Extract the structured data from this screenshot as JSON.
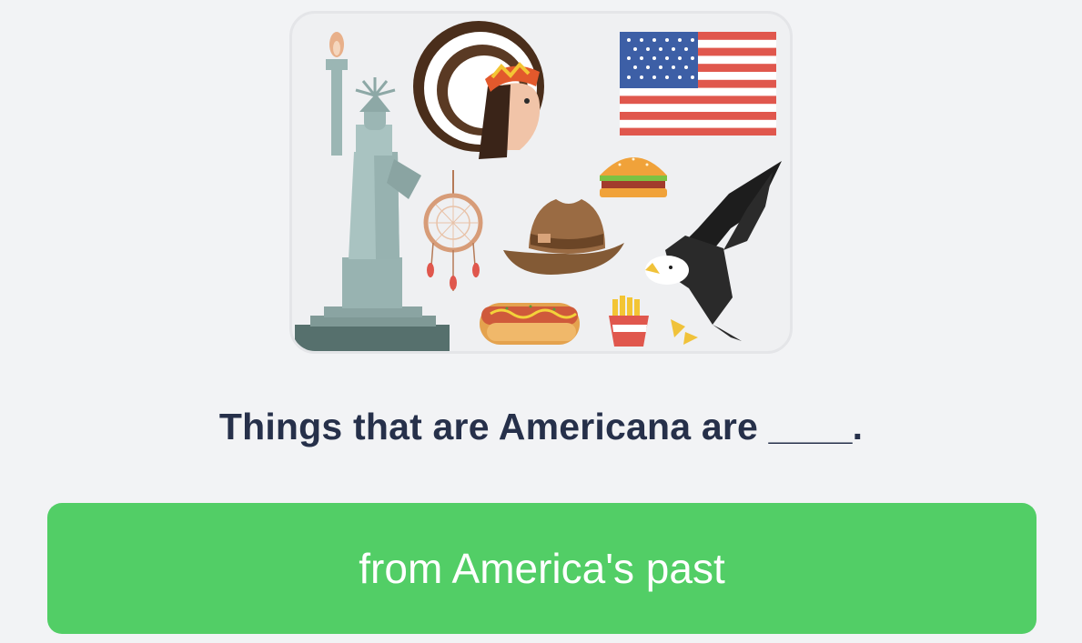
{
  "question": {
    "text": "Things that are Americana are ____."
  },
  "answer_option": {
    "label": "from America's past"
  },
  "illustration": {
    "icons": [
      "statue-of-liberty",
      "native-headdress",
      "american-flag",
      "dreamcatcher",
      "cowboy-hat",
      "hamburger",
      "bald-eagle",
      "hot-dog",
      "french-fries"
    ]
  },
  "colors": {
    "background": "#f2f3f5",
    "question_text": "#26304a",
    "answer_button": "#52ce66",
    "answer_text": "#ffffff"
  }
}
